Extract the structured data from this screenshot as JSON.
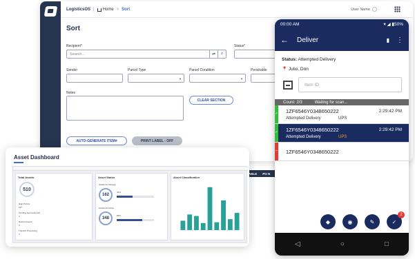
{
  "web": {
    "app_name": "LogisticsOS",
    "breadcrumb_home": "Home",
    "breadcrumb_sep": ">",
    "breadcrumb_current": "Sort",
    "user_name": "User Name",
    "page_title": "Sort",
    "recipient_label": "Recipient*",
    "search_placeholder": "Search...",
    "status_label": "Status*",
    "sender_label": "Sender",
    "parcel_type_label": "Parcel Type",
    "parcel_condition_label": "Parcel Condition",
    "perishable_label": "Perishable",
    "notes_label": "Notes",
    "clear_section": "CLEAR SECTION",
    "auto_generate": "AUTO-GENERATE ITEM#",
    "print_label": "PRINT LABEL - OFF",
    "table_cols": [
      "ABLE",
      "PO N"
    ]
  },
  "phone": {
    "time": "00:00 AM",
    "battery": "50%",
    "title": "Deliver",
    "status_prefix": "Status:",
    "status_value": "Attempted Delivery",
    "location": "Julio, Don",
    "item_placeholder": "Item ID",
    "count": "Count: 2/3",
    "waiting": "Waiting for scan...",
    "rows": [
      {
        "tracking": "1ZF6546Y0348650222",
        "time": "2:29:42 PM",
        "status": "Attempted Delivery",
        "carrier": "UPS",
        "color": "#2fbf3a"
      },
      {
        "tracking": "1ZF6546Y0348650222",
        "time": "2:29:42 PM",
        "status": "Attempted Delivery",
        "carrier": "UPS",
        "color": "#2fbf3a"
      },
      {
        "tracking": "1ZF6546Y0348650222",
        "time": "",
        "status": "",
        "carrier": "",
        "color": "#e53935"
      }
    ],
    "fab_badge": "2"
  },
  "dashboard": {
    "title": "Asset Dashboard",
    "panel1_title": "Total Assets",
    "total_assets": "510",
    "panel1_items": [
      "High Priority",
      "237",
      "Pending Approvals Ad3",
      "4",
      "Retired Assets",
      "4",
      "Transfer Processing",
      "4"
    ],
    "panel2_title": "Asset Status",
    "status_a_label": "Awaits for Storage",
    "status_a_value": "162",
    "status_a_pct": "42%",
    "status_a_fraction": 0.42,
    "status_b_label": "Awaits for Active",
    "status_b_value": "348",
    "status_b_pct": "68%",
    "status_b_fraction": 0.68,
    "panel3_title": "Asset Classification"
  },
  "chart_data": {
    "type": "bar",
    "title": "Asset Classification",
    "categories": [
      "",
      "",
      "",
      "",
      "",
      "",
      "",
      "",
      ""
    ],
    "values": [
      12,
      20,
      18,
      9,
      55,
      10,
      38,
      14,
      22
    ],
    "ylim": [
      0,
      60
    ],
    "color": "#2aa198"
  }
}
